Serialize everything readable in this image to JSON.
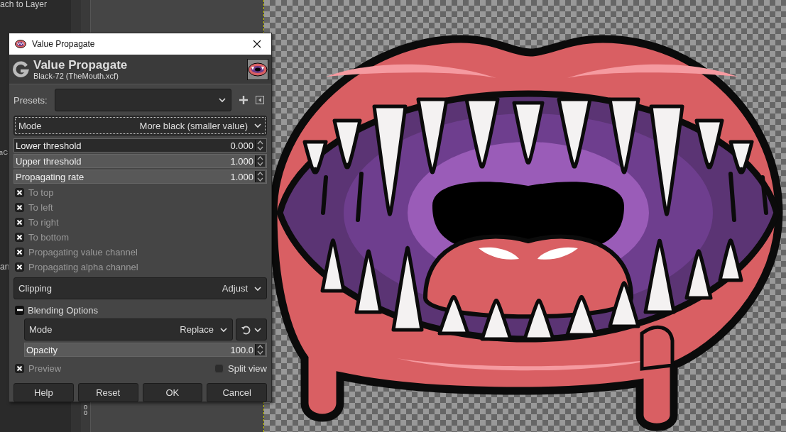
{
  "background": {
    "panel_texts": [
      "ach to Layer",
      "a C",
      "an"
    ],
    "ruler_labels": [
      "0",
      "0"
    ]
  },
  "dialog": {
    "title": "Value Propagate",
    "header": {
      "title": "Value Propagate",
      "subtitle": "Black-72 (TheMouth.xcf)"
    },
    "presets": {
      "label": "Presets:"
    },
    "mode": {
      "label": "Mode",
      "value": "More black (smaller value)"
    },
    "spinners": [
      {
        "label": "Lower threshold",
        "value": "0.000",
        "level": 0
      },
      {
        "label": "Upper threshold",
        "value": "1.000",
        "level": 1
      },
      {
        "label": "Propagating rate",
        "value": "1.000",
        "level": 1
      }
    ],
    "checkboxes": [
      {
        "label": "To top",
        "checked": true
      },
      {
        "label": "To left",
        "checked": true
      },
      {
        "label": "To right",
        "checked": true
      },
      {
        "label": "To bottom",
        "checked": true
      },
      {
        "label": "Propagating value channel",
        "checked": true
      },
      {
        "label": "Propagating alpha channel",
        "checked": true
      }
    ],
    "clipping": {
      "label": "Clipping",
      "value": "Adjust"
    },
    "blending": {
      "label": "Blending Options",
      "expanded": true,
      "mode": {
        "label": "Mode",
        "value": "Replace"
      },
      "opacity": {
        "label": "Opacity",
        "value": "100.0",
        "level": 1
      }
    },
    "preview": {
      "label": "Preview",
      "checked": true
    },
    "split_view": {
      "label": "Split view",
      "checked": false
    },
    "buttons": [
      "Help",
      "Reset",
      "OK",
      "Cancel"
    ]
  }
}
